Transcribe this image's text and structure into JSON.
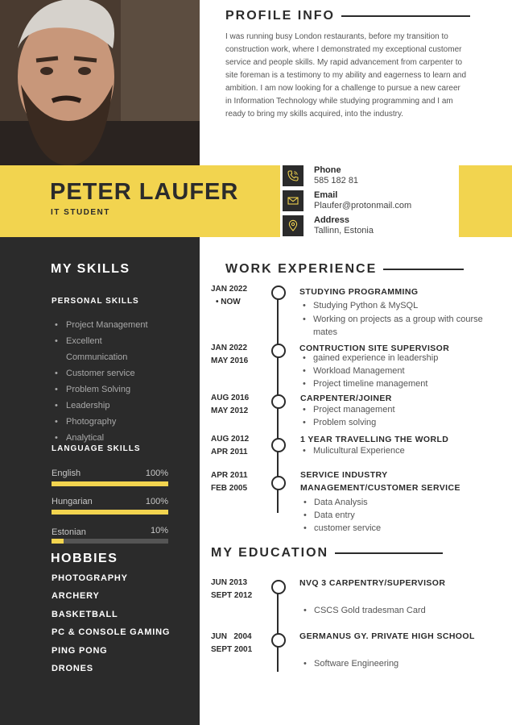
{
  "profile": {
    "heading": "PROFILE INFO",
    "text": "I was running busy London restaurants, before my transition to construction work, where I demonstrated my exceptional customer service and people skills. My rapid advancement from carpenter to site foreman is a testimony to my ability and eagerness to learn and ambition. I am now looking for a challenge to pursue a new career in Information Technology while studying programming and I am ready to bring my skills acquired, into the industry."
  },
  "person": {
    "name": "PETER LAUFER",
    "title": "IT STUDENT"
  },
  "contact": [
    {
      "label": "Phone",
      "value": "585 182 81",
      "icon": "phone-icon"
    },
    {
      "label": "Email",
      "value": "Plaufer@protonmail.com",
      "icon": "envelope-icon"
    },
    {
      "label": "Address",
      "value": "Tallinn, Estonia",
      "icon": "location-pin-icon"
    }
  ],
  "skills": {
    "heading": "MY SKILLS",
    "personal_heading": "PERSONAL SKILLS",
    "personal": [
      "Project Management",
      "Excellent",
      "Communication",
      "Customer service",
      "Problem Solving",
      "Leadership",
      "Photography",
      "Analytical"
    ],
    "language_heading": "LANGUAGE SKILLS",
    "languages": [
      {
        "name": "English",
        "percent_label": "100%",
        "level": 100
      },
      {
        "name": "Hungarian",
        "percent_label": "100%",
        "level": 100
      },
      {
        "name": "Estonian",
        "percent_label": "10%",
        "level": 10
      }
    ]
  },
  "hobbies": {
    "heading": "HOBBIES",
    "items": [
      "PHOTOGRAPHY",
      "ARCHERY",
      "BASKETBALL",
      "PC & CONSOLE GAMING",
      "PING PONG",
      "DRONES"
    ]
  },
  "work": {
    "heading": "WORK EXPERIENCE",
    "entries": [
      {
        "date1": "JAN 2022",
        "date2": "•  NOW",
        "title": "STUDYING PROGRAMMING",
        "bullets": [
          "Studying Python & MySQL",
          "Working on projects as a group with course mates"
        ]
      },
      {
        "date1": "JAN 2022",
        "date2": "MAY 2016",
        "title": "CONTRUCTION SITE SUPERVISOR",
        "bullets": [
          "gained experience in leadership",
          "Workload Management",
          "Project timeline management"
        ]
      },
      {
        "date1": "AUG 2016",
        "date2": "MAY 2012",
        "title": "CARPENTER/JOINER",
        "bullets": [
          "Project management",
          "Problem solving"
        ]
      },
      {
        "date1": "AUG 2012",
        "date2": "APR  2011",
        "title": "1 YEAR TRAVELLING THE WORLD",
        "bullets": [
          "Mulicultural Experience"
        ]
      },
      {
        "date1": "APR 2011",
        "date2": "FEB 2005",
        "title": "SERVICE INDUSTRY",
        "title2": "MANAGEMENT/CUSTOMER SERVICE",
        "bullets": [
          "Data Analysis",
          "Data entry",
          "customer service"
        ]
      }
    ]
  },
  "education": {
    "heading": "MY EDUCATION",
    "entries": [
      {
        "date1": "JUN 2013",
        "date2": "SEPT 2012",
        "title": "NVQ 3 CARPENTRY/SUPERVISOR",
        "bullets": [
          "CSCS Gold  tradesman Card"
        ]
      },
      {
        "date1": "JUN   2004",
        "date2": "SEPT 2001",
        "title": "GERMANUS GY. PRIVATE HIGH SCHOOL",
        "bullets": [
          "Software Engineering"
        ]
      }
    ]
  },
  "colors": {
    "dark": "#2b2b2b",
    "accent": "#f2d44f"
  }
}
